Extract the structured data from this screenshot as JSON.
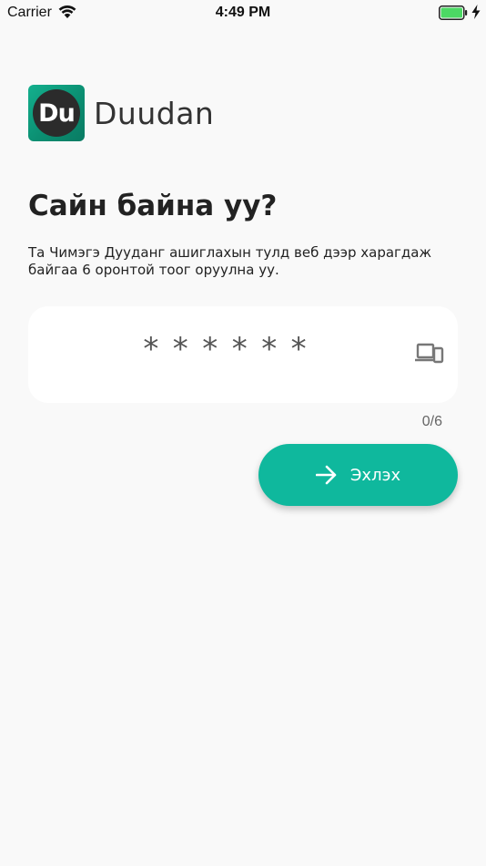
{
  "status_bar": {
    "carrier": "Carrier",
    "time": "4:49 PM",
    "icons": [
      "wifi-icon",
      "battery-icon",
      "charging-bolt-icon"
    ]
  },
  "logo": {
    "badge_text": "Du",
    "name": "Duudan"
  },
  "greeting": "Сайн байна уу?",
  "instructions": "Та Чимэгэ Дууданг ашиглахын тулд веб дээр харагдаж байгаа 6 оронтой тоог оруулна уу.",
  "code_input": {
    "value": "",
    "placeholder": "******",
    "icon": "devices-icon",
    "counter": "0/6"
  },
  "start_button": {
    "label": "Эхлэх",
    "icon": "arrow-right-icon"
  },
  "colors": {
    "accent": "#0fb89d",
    "background": "#f9f9f9",
    "card": "#ffffff",
    "text": "#222222"
  }
}
